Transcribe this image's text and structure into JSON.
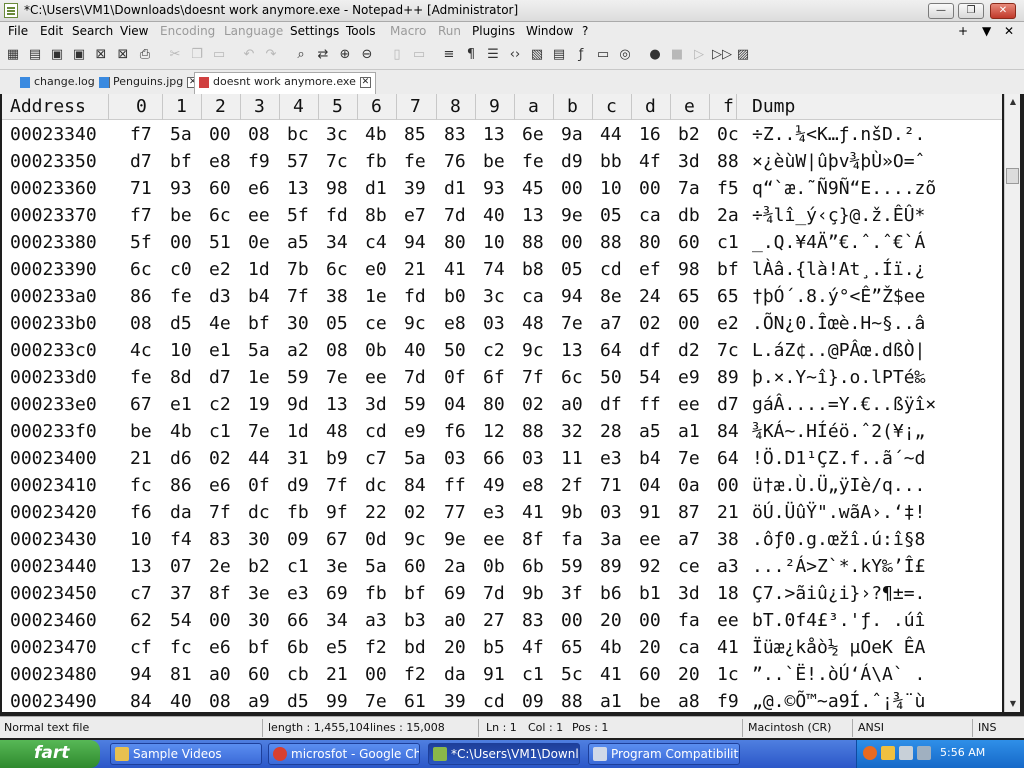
{
  "window": {
    "title": "*C:\\Users\\VM1\\Downloads\\doesnt work anymore.exe - Notepad++ [Administrator]",
    "minimize_label": "—",
    "maximize_label": "❐",
    "close_label": "✕"
  },
  "menu": {
    "items": [
      "File",
      "Edit",
      "Search",
      "View",
      "Encoding",
      "Language",
      "Settings",
      "Tools",
      "Macro",
      "Run",
      "Plugins",
      "Window",
      "?"
    ],
    "disabled": [
      "Encoding",
      "Language",
      "Macro",
      "Run"
    ],
    "right_plus": "+",
    "right_down": "▼",
    "right_close": "✕"
  },
  "toolbar": {
    "icons": [
      "new-icon",
      "open-icon",
      "save-icon",
      "save-all-icon",
      "close-icon",
      "close-all-icon",
      "print-icon",
      "cut-icon",
      "copy-icon",
      "paste-icon",
      "undo-icon",
      "redo-icon",
      "find-icon",
      "replace-icon",
      "zoom-in-icon",
      "zoom-out-icon",
      "sync-v-icon",
      "sync-h-icon",
      "wrap-icon",
      "all-chars-icon",
      "indent-guide-icon",
      "xml-icon",
      "map-icon",
      "doc-list-icon",
      "function-list-icon",
      "monitor-icon",
      "settings-icon",
      "record-icon",
      "stop-icon",
      "play-icon",
      "play-multi-icon",
      "save-macro-icon"
    ]
  },
  "tabs": [
    {
      "label": "change.log",
      "close": "✕"
    },
    {
      "label": "Penguins.jpg",
      "close": "✕"
    },
    {
      "label": "doesnt work anymore.exe",
      "close": "✕"
    }
  ],
  "hex": {
    "header": {
      "address": "Address",
      "cols": [
        "0",
        "1",
        "2",
        "3",
        "4",
        "5",
        "6",
        "7",
        "8",
        "9",
        "a",
        "b",
        "c",
        "d",
        "e",
        "f"
      ],
      "dump": "Dump"
    },
    "rows": [
      {
        "addr": "00023340",
        "bytes": [
          "f7",
          "5a",
          "00",
          "08",
          "bc",
          "3c",
          "4b",
          "85",
          "83",
          "13",
          "6e",
          "9a",
          "44",
          "16",
          "b2",
          "0c"
        ],
        "dump": "÷Z..¼<K…ƒ.nšD.²."
      },
      {
        "addr": "00023350",
        "bytes": [
          "d7",
          "bf",
          "e8",
          "f9",
          "57",
          "7c",
          "fb",
          "fe",
          "76",
          "be",
          "fe",
          "d9",
          "bb",
          "4f",
          "3d",
          "88"
        ],
        "dump": "×¿èùW|ûþv¾þÙ»O=ˆ"
      },
      {
        "addr": "00023360",
        "bytes": [
          "71",
          "93",
          "60",
          "e6",
          "13",
          "98",
          "d1",
          "39",
          "d1",
          "93",
          "45",
          "00",
          "10",
          "00",
          "7a",
          "f5"
        ],
        "dump": "q“`æ.˜Ñ9Ñ“E....zõ"
      },
      {
        "addr": "00023370",
        "bytes": [
          "f7",
          "be",
          "6c",
          "ee",
          "5f",
          "fd",
          "8b",
          "e7",
          "7d",
          "40",
          "13",
          "9e",
          "05",
          "ca",
          "db",
          "2a"
        ],
        "dump": "÷¾lî_ý‹ç}@.ž.ÊÛ*"
      },
      {
        "addr": "00023380",
        "bytes": [
          "5f",
          "00",
          "51",
          "0e",
          "a5",
          "34",
          "c4",
          "94",
          "80",
          "10",
          "88",
          "00",
          "88",
          "80",
          "60",
          "c1"
        ],
        "dump": "_.Q.¥4Ä”€.ˆ.ˆ€`Á"
      },
      {
        "addr": "00023390",
        "bytes": [
          "6c",
          "c0",
          "e2",
          "1d",
          "7b",
          "6c",
          "e0",
          "21",
          "41",
          "74",
          "b8",
          "05",
          "cd",
          "ef",
          "98",
          "bf"
        ],
        "dump": "lÀâ.{là!At¸.Íï.¿"
      },
      {
        "addr": "000233a0",
        "bytes": [
          "86",
          "fe",
          "d3",
          "b4",
          "7f",
          "38",
          "1e",
          "fd",
          "b0",
          "3c",
          "ca",
          "94",
          "8e",
          "24",
          "65",
          "65"
        ],
        "dump": "†þÓ´.8.ý°<Ê”Ž$ee"
      },
      {
        "addr": "000233b0",
        "bytes": [
          "08",
          "d5",
          "4e",
          "bf",
          "30",
          "05",
          "ce",
          "9c",
          "e8",
          "03",
          "48",
          "7e",
          "a7",
          "02",
          "00",
          "e2"
        ],
        "dump": ".ÕN¿0.Îœè.H~§..â"
      },
      {
        "addr": "000233c0",
        "bytes": [
          "4c",
          "10",
          "e1",
          "5a",
          "a2",
          "08",
          "0b",
          "40",
          "50",
          "c2",
          "9c",
          "13",
          "64",
          "df",
          "d2",
          "7c"
        ],
        "dump": "L.áZ¢..@PÂœ.dßÒ|"
      },
      {
        "addr": "000233d0",
        "bytes": [
          "fe",
          "8d",
          "d7",
          "1e",
          "59",
          "7e",
          "ee",
          "7d",
          "0f",
          "6f",
          "7f",
          "6c",
          "50",
          "54",
          "e9",
          "89"
        ],
        "dump": "þ.×.Y~î}.o.lPTé‰"
      },
      {
        "addr": "000233e0",
        "bytes": [
          "67",
          "e1",
          "c2",
          "19",
          "9d",
          "13",
          "3d",
          "59",
          "04",
          "80",
          "02",
          "a0",
          "df",
          "ff",
          "ee",
          "d7"
        ],
        "dump": "gáÂ....=Y.€..ßÿî×"
      },
      {
        "addr": "000233f0",
        "bytes": [
          "be",
          "4b",
          "c1",
          "7e",
          "1d",
          "48",
          "cd",
          "e9",
          "f6",
          "12",
          "88",
          "32",
          "28",
          "a5",
          "a1",
          "84"
        ],
        "dump": "¾KÁ~.HÍéö.ˆ2(¥¡„"
      },
      {
        "addr": "00023400",
        "bytes": [
          "21",
          "d6",
          "02",
          "44",
          "31",
          "b9",
          "c7",
          "5a",
          "03",
          "66",
          "03",
          "11",
          "e3",
          "b4",
          "7e",
          "64"
        ],
        "dump": "!Ö.D1¹ÇZ.f..ã´~d"
      },
      {
        "addr": "00023410",
        "bytes": [
          "fc",
          "86",
          "e6",
          "0f",
          "d9",
          "7f",
          "dc",
          "84",
          "ff",
          "49",
          "e8",
          "2f",
          "71",
          "04",
          "0a",
          "00"
        ],
        "dump": "ü†æ.Ù.Ü„ÿIè/q..."
      },
      {
        "addr": "00023420",
        "bytes": [
          "f6",
          "da",
          "7f",
          "dc",
          "fb",
          "9f",
          "22",
          "02",
          "77",
          "e3",
          "41",
          "9b",
          "03",
          "91",
          "87",
          "21"
        ],
        "dump": "öÚ.ÜûŸ\".wãA›.‘‡!"
      },
      {
        "addr": "00023430",
        "bytes": [
          "10",
          "f4",
          "83",
          "30",
          "09",
          "67",
          "0d",
          "9c",
          "9e",
          "ee",
          "8f",
          "fa",
          "3a",
          "ee",
          "a7",
          "38"
        ],
        "dump": ".ôƒ0.g.œžî.ú:î§8"
      },
      {
        "addr": "00023440",
        "bytes": [
          "13",
          "07",
          "2e",
          "b2",
          "c1",
          "3e",
          "5a",
          "60",
          "2a",
          "0b",
          "6b",
          "59",
          "89",
          "92",
          "ce",
          "a3"
        ],
        "dump": "...²Á>Z`*.kY‰’Î£"
      },
      {
        "addr": "00023450",
        "bytes": [
          "c7",
          "37",
          "8f",
          "3e",
          "e3",
          "69",
          "fb",
          "bf",
          "69",
          "7d",
          "9b",
          "3f",
          "b6",
          "b1",
          "3d",
          "18"
        ],
        "dump": "Ç7.>ãiû¿i}›?¶±=."
      },
      {
        "addr": "00023460",
        "bytes": [
          "62",
          "54",
          "00",
          "30",
          "66",
          "34",
          "a3",
          "b3",
          "a0",
          "27",
          "83",
          "00",
          "20",
          "00",
          "fa",
          "ee"
        ],
        "dump": "bT.0f4£³.'ƒ. .úî"
      },
      {
        "addr": "00023470",
        "bytes": [
          "cf",
          "fc",
          "e6",
          "bf",
          "6b",
          "e5",
          "f2",
          "bd",
          "20",
          "b5",
          "4f",
          "65",
          "4b",
          "20",
          "ca",
          "41"
        ],
        "dump": "Ïüæ¿kåò½ µOeK ÊA"
      },
      {
        "addr": "00023480",
        "bytes": [
          "94",
          "81",
          "a0",
          "60",
          "cb",
          "21",
          "00",
          "f2",
          "da",
          "91",
          "c1",
          "5c",
          "41",
          "60",
          "20",
          "1c"
        ],
        "dump": "”..`Ë!.òÚ‘Á\\A` ."
      },
      {
        "addr": "00023490",
        "bytes": [
          "84",
          "40",
          "08",
          "a9",
          "d5",
          "99",
          "7e",
          "61",
          "39",
          "cd",
          "09",
          "88",
          "a1",
          "be",
          "a8",
          "f9"
        ],
        "dump": "„@.©Õ™~a9Í.ˆ¡¾¨ù"
      }
    ]
  },
  "status": {
    "mode": "Normal text file",
    "length": "length : 1,455,104",
    "lines": "lines : 15,008",
    "ln": "Ln : 1",
    "col": "Col : 1",
    "pos": "Pos : 1",
    "eol": "Macintosh (CR)",
    "encoding": "ANSI",
    "ins": "INS"
  },
  "taskbar": {
    "start_label": "fart",
    "tasks": [
      {
        "label": "Sample Videos"
      },
      {
        "label": "microsfot - Google Chr..."
      },
      {
        "label": "*C:\\Users\\VM1\\Downl..."
      },
      {
        "label": "Program Compatibility..."
      }
    ],
    "clock": "5:56 AM"
  }
}
